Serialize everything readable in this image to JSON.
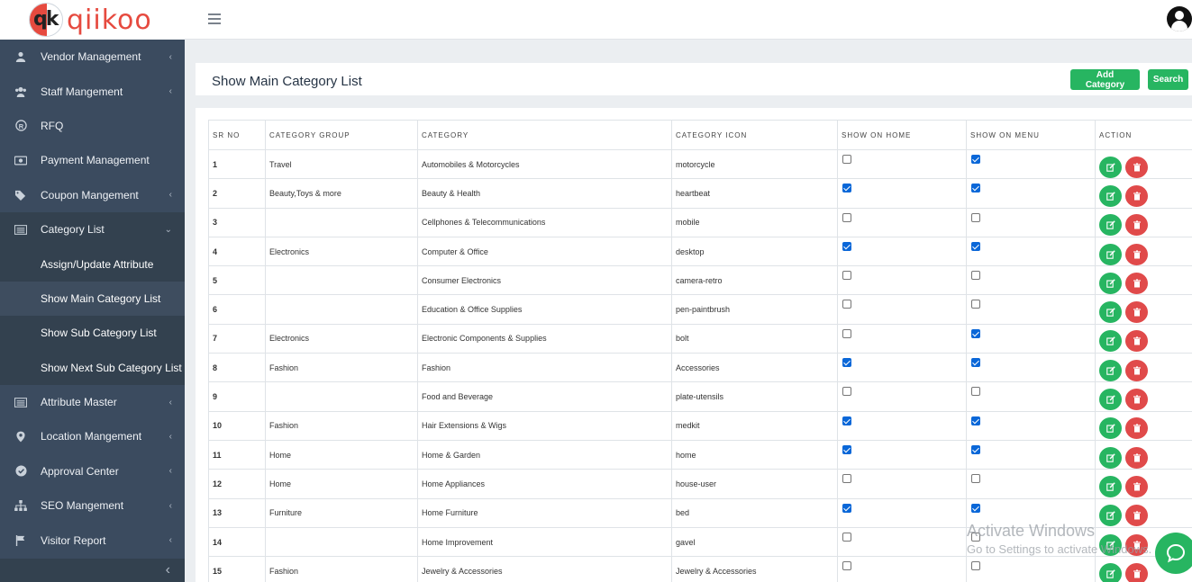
{
  "brand": {
    "logo_text": "qiikoo",
    "logo_mark": "qk",
    "accent": "#e64a3f"
  },
  "sidebar": {
    "items": [
      {
        "label": "Vendor Management",
        "icon": "user-icon"
      },
      {
        "label": "Staff Mangement",
        "icon": "users-icon"
      },
      {
        "label": "RFQ",
        "icon": "registered-icon"
      },
      {
        "label": "Payment Management",
        "icon": "money-icon"
      },
      {
        "label": "Coupon Mangement",
        "icon": "tags-icon"
      },
      {
        "label": "Category List",
        "icon": "list-icon"
      },
      {
        "label": "Attribute Master",
        "icon": "list-icon"
      },
      {
        "label": "Location Mangement",
        "icon": "map-marker-icon"
      },
      {
        "label": "Approval Center",
        "icon": "check-circle-icon"
      },
      {
        "label": "SEO Mangement",
        "icon": "sitemap-icon"
      },
      {
        "label": "Visitor Report",
        "icon": "flag-icon"
      }
    ],
    "category_subitems": [
      "Assign/Update Attribute",
      "Show Main Category List",
      "Show Sub Category List",
      "Show Next Sub Category List"
    ]
  },
  "header": {
    "title": "Show Main Category List",
    "add_label": "Add Category",
    "search_label": "Search"
  },
  "table": {
    "columns": [
      "SR NO",
      "CATEGORY GROUP",
      "CATEGORY",
      "CATEGORY ICON",
      "SHOW ON HOME",
      "SHOW ON MENU",
      "ACTION"
    ],
    "rows": [
      {
        "sr": "1",
        "group": "Travel",
        "category": "Automobiles & Motorcycles",
        "icon": "motorcycle",
        "home": false,
        "menu": true
      },
      {
        "sr": "2",
        "group": "Beauty,Toys & more",
        "category": "Beauty & Health",
        "icon": "heartbeat",
        "home": true,
        "menu": true
      },
      {
        "sr": "3",
        "group": "",
        "category": "Cellphones & Telecommunications",
        "icon": "mobile",
        "home": false,
        "menu": false
      },
      {
        "sr": "4",
        "group": "Electronics",
        "category": "Computer & Office",
        "icon": "desktop",
        "home": true,
        "menu": true
      },
      {
        "sr": "5",
        "group": "",
        "category": "Consumer Electronics",
        "icon": "camera-retro",
        "home": false,
        "menu": false
      },
      {
        "sr": "6",
        "group": "",
        "category": "Education & Office Supplies",
        "icon": "pen-paintbrush",
        "home": false,
        "menu": false
      },
      {
        "sr": "7",
        "group": "Electronics",
        "category": "Electronic Components & Supplies",
        "icon": "bolt",
        "home": false,
        "menu": true
      },
      {
        "sr": "8",
        "group": "Fashion",
        "category": "Fashion",
        "icon": "Accessories",
        "home": true,
        "menu": true
      },
      {
        "sr": "9",
        "group": "",
        "category": "Food and Beverage",
        "icon": "plate-utensils",
        "home": false,
        "menu": false
      },
      {
        "sr": "10",
        "group": "Fashion",
        "category": "Hair Extensions & Wigs",
        "icon": "medkit",
        "home": true,
        "menu": true
      },
      {
        "sr": "11",
        "group": "Home",
        "category": "Home & Garden",
        "icon": "home",
        "home": true,
        "menu": true
      },
      {
        "sr": "12",
        "group": "Home",
        "category": "Home Appliances",
        "icon": "house-user",
        "home": false,
        "menu": false
      },
      {
        "sr": "13",
        "group": "Furniture",
        "category": "Home Furniture",
        "icon": "bed",
        "home": true,
        "menu": true
      },
      {
        "sr": "14",
        "group": "",
        "category": "Home Improvement",
        "icon": "gavel",
        "home": false,
        "menu": false
      },
      {
        "sr": "15",
        "group": "Fashion",
        "category": "Jewelry & Accessories",
        "icon": "Jewelry & Accessories",
        "home": false,
        "menu": false
      }
    ]
  },
  "watermark": {
    "line1": "Activate Windows",
    "line2": "Go to Settings to activate Windows."
  },
  "colors": {
    "sidebar": "#3b4b5f",
    "success": "#27b561",
    "danger": "#e04a4a",
    "checkbox": "#0a67d8"
  }
}
